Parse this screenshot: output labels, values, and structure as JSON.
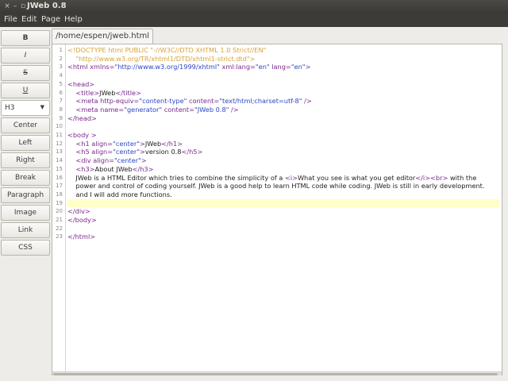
{
  "window": {
    "title": "JWeb 0.8",
    "buttons": [
      "×",
      "–",
      "▫"
    ]
  },
  "menu": [
    "File",
    "Edit",
    "Page",
    "Help"
  ],
  "sidebar": {
    "buttons": [
      {
        "label": "B",
        "style": "bold"
      },
      {
        "label": "I",
        "style": "italic"
      },
      {
        "label": "S",
        "style": "strike"
      },
      {
        "label": "U",
        "style": "under"
      }
    ],
    "heading_select": "H3",
    "actions": [
      "Center",
      "Left",
      "Right",
      "Break",
      "Paragraph",
      "Image",
      "Link",
      "CSS"
    ]
  },
  "tab": {
    "label": "/home/espen/jweb.html"
  },
  "editor": {
    "highlight_line": 19,
    "lines": [
      [
        [
          "doc",
          "<!DOCTYPE html PUBLIC \"-//W3C//DTD XHTML 1.0 Strict//EN\""
        ]
      ],
      [
        [
          "doc",
          "    \"http://www.w3.org/TR/xhtml1/DTD/xhtml1-strict.dtd\">"
        ]
      ],
      [
        [
          "tag",
          "<html "
        ],
        [
          "attr",
          "xmlns="
        ],
        [
          "val",
          "\"http://www.w3.org/1999/xhtml\""
        ],
        [
          "attr",
          " xml:lang="
        ],
        [
          "val",
          "\"en\""
        ],
        [
          "attr",
          " lang="
        ],
        [
          "val",
          "\"en\""
        ],
        [
          "tag",
          ">"
        ]
      ],
      [],
      [
        [
          "tag",
          "<head>"
        ]
      ],
      [
        [
          "txt",
          "    "
        ],
        [
          "tag",
          "<title>"
        ],
        [
          "txt",
          "JWeb"
        ],
        [
          "tag",
          "</title>"
        ]
      ],
      [
        [
          "txt",
          "    "
        ],
        [
          "tag",
          "<meta "
        ],
        [
          "attr",
          "http-equiv="
        ],
        [
          "val",
          "\"content-type\""
        ],
        [
          "attr",
          " content="
        ],
        [
          "val",
          "\"text/html;charset=utf-8\""
        ],
        [
          "tag",
          " />"
        ]
      ],
      [
        [
          "txt",
          "    "
        ],
        [
          "tag",
          "<meta "
        ],
        [
          "attr",
          "name="
        ],
        [
          "val",
          "\"generator\""
        ],
        [
          "attr",
          " content="
        ],
        [
          "val",
          "\"JWeb 0.8\""
        ],
        [
          "tag",
          " />"
        ]
      ],
      [
        [
          "tag",
          "</head>"
        ]
      ],
      [],
      [
        [
          "tag",
          "<body >"
        ]
      ],
      [
        [
          "txt",
          "    "
        ],
        [
          "tag",
          "<h1 "
        ],
        [
          "attr",
          "align="
        ],
        [
          "val",
          "\"center\""
        ],
        [
          "tag",
          ">"
        ],
        [
          "txt",
          "JWeb"
        ],
        [
          "tag",
          "</h1>"
        ]
      ],
      [
        [
          "txt",
          "    "
        ],
        [
          "tag",
          "<h5 "
        ],
        [
          "attr",
          "align="
        ],
        [
          "val",
          "\"center\""
        ],
        [
          "tag",
          ">"
        ],
        [
          "txt",
          "version 0.8"
        ],
        [
          "tag",
          "</h5>"
        ]
      ],
      [
        [
          "txt",
          "    "
        ],
        [
          "tag",
          "<div "
        ],
        [
          "attr",
          "align="
        ],
        [
          "val",
          "\"center\""
        ],
        [
          "tag",
          ">"
        ]
      ],
      [
        [
          "txt",
          "    "
        ],
        [
          "tag",
          "<h3>"
        ],
        [
          "txt",
          "About JWeb"
        ],
        [
          "tag",
          "</h3>"
        ]
      ],
      [
        [
          "txt",
          "    JWeb is a HTML Editor which tries to combine the simplicity of a "
        ],
        [
          "tag",
          "<i>"
        ],
        [
          "txt",
          "What you see is what you get editor"
        ],
        [
          "tag",
          "</i><br>"
        ],
        [
          "txt",
          " with the"
        ]
      ],
      [
        [
          "txt",
          "    power and control of coding yourself. JWeb is a good help to learn HTML code while coding. JWeb is still in early development."
        ]
      ],
      [
        [
          "txt",
          "    and I will add more functions."
        ]
      ],
      [],
      [
        [
          "tag",
          "</div>"
        ]
      ],
      [
        [
          "tag",
          "</body>"
        ]
      ],
      [],
      [
        [
          "tag",
          "</html>"
        ]
      ]
    ]
  }
}
